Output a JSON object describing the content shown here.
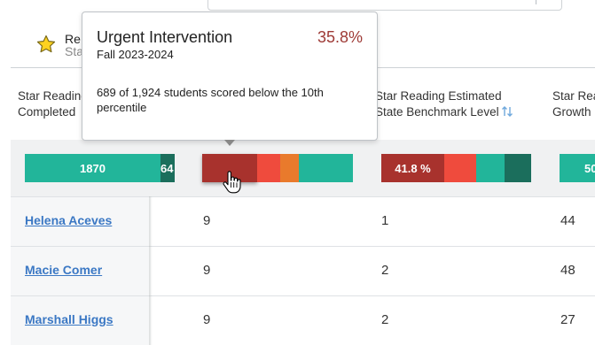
{
  "report": {
    "title": "Re",
    "subtitle": "Sta"
  },
  "columns": [
    {
      "line1": "Star Reading",
      "line2": "Completed"
    },
    {
      "line1": "Star Reading Estimated",
      "line2": "State Benchmark Level"
    },
    {
      "line1": "Star Rea",
      "line2": "Growth"
    }
  ],
  "summary_bars": {
    "completed": {
      "label_a": "1870",
      "label_b": "64"
    },
    "benchmark": {
      "label_a": "41.8 %"
    },
    "growth": {
      "label_a": "50"
    }
  },
  "tooltip": {
    "title": "Urgent Intervention",
    "percent": "35.8%",
    "term": "Fall 2023-2024",
    "body": "689 of 1,924 students scored below the 10th percentile"
  },
  "students": [
    {
      "name": "Helena Aceves",
      "completed": "9",
      "benchmark": "1",
      "growth": "44"
    },
    {
      "name": "Macie Comer",
      "completed": "9",
      "benchmark": "2",
      "growth": "48"
    },
    {
      "name": "Marshall Higgs",
      "completed": "9",
      "benchmark": "2",
      "growth": "27"
    }
  ],
  "colors": {
    "urgent": "#a8322d",
    "intervention": "#ef4b3d",
    "on_watch": "#e97a2c",
    "at_benchmark": "#22b59a",
    "above_benchmark": "#1b6e5c",
    "link": "#3b78c4"
  }
}
